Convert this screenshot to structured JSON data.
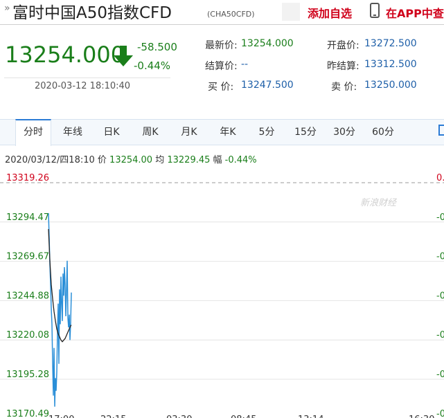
{
  "header": {
    "title": "富时中国A50指数CFD",
    "code": "(CHA50CFD)",
    "add_watch": "添加自选",
    "app_link": "在APP中查"
  },
  "quote": {
    "price": "13254.000",
    "change": "-58.500",
    "change_pct": "-0.44%",
    "datetime": "2020-03-12 18:10:40",
    "fields": {
      "latest_label": "最新价:",
      "latest": "13254.000",
      "open_label": "开盘价:",
      "open": "13272.500",
      "settle_label": "结算价:",
      "settle": "--",
      "prev_settle_label": "昨结算:",
      "prev_settle": "13312.500",
      "bid_label": "买 价:",
      "bid": "13247.500",
      "ask_label": "卖 价:",
      "ask": "13250.000"
    }
  },
  "tabs": [
    "分时",
    "年线",
    "日K",
    "周K",
    "月K",
    "年K",
    "5分",
    "15分",
    "30分",
    "60分"
  ],
  "active_tab": 0,
  "info_bar": "2020/03/12/四18:10 价 13254.00 均 13229.45 幅 -0.44%",
  "watermark": "新浪财经",
  "colors": {
    "down": "#1a7e1a",
    "up": "#d0021b",
    "price_line": "#2b8fd8",
    "avg_line": "#222222"
  },
  "chart_data": {
    "type": "line",
    "y_labels": [
      "13319.26",
      "13294.47",
      "13269.67",
      "13244.88",
      "13220.08",
      "13195.28",
      "13170.49"
    ],
    "right_labels": [
      "0.",
      "-0",
      "-0",
      "-0",
      "-0",
      "-0",
      "-0"
    ],
    "x_labels": [
      "17:00",
      "22:15",
      "03:30",
      "08:45",
      "13:14",
      "16:30"
    ],
    "series": [
      {
        "x": [
          0,
          1,
          2,
          3,
          4,
          5,
          6,
          7,
          8,
          9,
          10,
          11,
          12,
          13,
          14,
          15,
          16,
          17,
          18,
          19,
          20,
          21,
          22,
          23,
          24,
          25,
          26,
          27,
          28,
          29,
          30,
          31,
          32,
          33
        ],
        "values": [
          13300,
          13285,
          13268,
          13255,
          13240,
          13230,
          13205,
          13185,
          13215,
          13178,
          13196,
          13188,
          13200,
          13225,
          13243,
          13205,
          13252,
          13230,
          13260,
          13243,
          13232,
          13262,
          13248,
          13266,
          13255,
          13235,
          13251,
          13270,
          13234,
          13228,
          13236,
          13220,
          13231,
          13250
        ]
      },
      {
        "x": [
          0,
          2,
          4,
          6,
          8,
          10,
          12,
          14,
          16,
          18,
          20,
          22,
          24,
          26,
          28,
          30,
          32,
          33
        ],
        "values": [
          13290,
          13270,
          13255,
          13246,
          13238,
          13232,
          13227,
          13224,
          13222,
          13220,
          13219,
          13220,
          13221,
          13223,
          13225,
          13227,
          13229,
          13229.45
        ]
      }
    ]
  }
}
